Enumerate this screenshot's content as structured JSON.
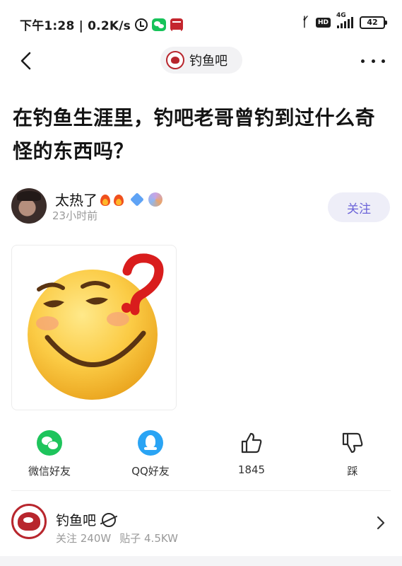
{
  "status_bar": {
    "time_and_speed": "下午1:28 | 0.2K/s",
    "hd_badge": "HD",
    "network": "4G",
    "battery": "42"
  },
  "nav": {
    "forum_name": "钓鱼吧",
    "icons": {
      "back": "chevron-left-icon",
      "more": "more-dots-icon"
    }
  },
  "post": {
    "title": "在钓鱼生涯里，钓吧老哥曾钓到过什么奇怪的东西吗？",
    "author": {
      "name": "太热了",
      "time": "23小时前",
      "follow_label": "关注"
    },
    "image_description_icon": "confused-emoji-with-question-mark"
  },
  "actions": [
    {
      "id": "wechat",
      "label": "微信好友",
      "icon": "wechat-icon"
    },
    {
      "id": "qq",
      "label": "QQ好友",
      "icon": "qq-icon"
    },
    {
      "id": "like",
      "label": "1845",
      "icon": "thumbs-up-icon"
    },
    {
      "id": "dislike",
      "label": "踩",
      "icon": "thumbs-down-icon"
    }
  ],
  "forum_card": {
    "name": "钓鱼吧",
    "followers": "关注 240W",
    "posts": "贴子 4.5KW"
  }
}
